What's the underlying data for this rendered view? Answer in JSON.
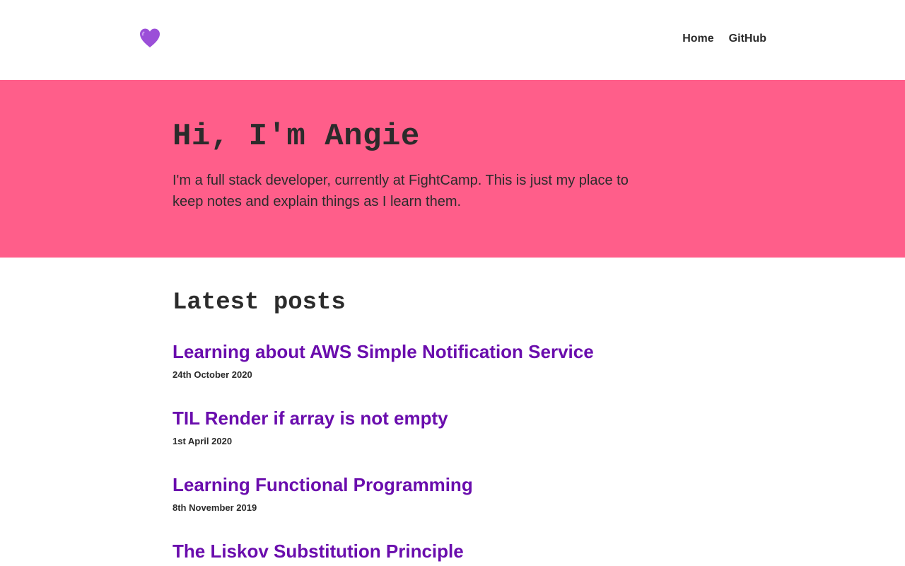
{
  "header": {
    "logo_icon": "purple-heart-icon",
    "nav": [
      {
        "label": "Home"
      },
      {
        "label": "GitHub"
      }
    ]
  },
  "hero": {
    "title": "Hi, I'm Angie",
    "text": "I'm a full stack developer, currently at FightCamp. This is just my place to keep notes and explain things as I learn them.",
    "background_color": "#ff5e8a"
  },
  "latest": {
    "heading": "Latest posts",
    "link_color": "#6a0dad",
    "posts": [
      {
        "title": "Learning about AWS Simple Notification Service",
        "date": "24th October 2020"
      },
      {
        "title": "TIL Render if array is not empty",
        "date": "1st April 2020"
      },
      {
        "title": "Learning Functional Programming",
        "date": "8th November 2019"
      },
      {
        "title": "The Liskov Substitution Principle",
        "date": ""
      }
    ]
  }
}
